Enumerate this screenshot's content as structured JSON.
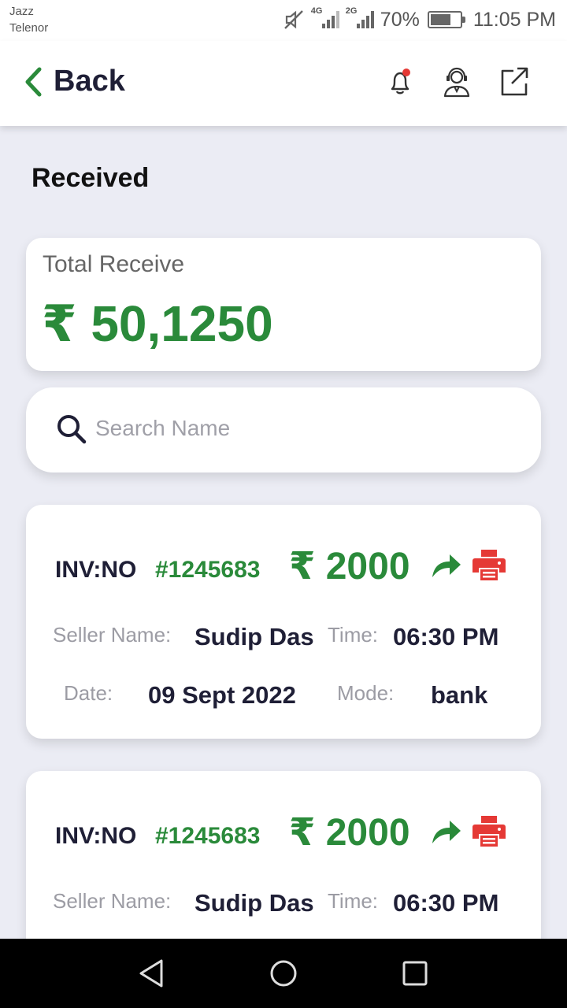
{
  "status_bar": {
    "carrier_1": "Jazz",
    "carrier_2": "Telenor",
    "network_1": "4G",
    "network_2": "2G",
    "battery": "70%",
    "battery_level": 0.7,
    "time": "11:05 PM"
  },
  "header": {
    "back_label": "Back",
    "icons": [
      "bell-icon",
      "support-agent-icon",
      "external-link-icon"
    ],
    "notification_dot_color": "#e53935"
  },
  "page_title": "Received",
  "summary": {
    "label": "Total Receive",
    "amount": "₹ 50,1250"
  },
  "search": {
    "placeholder": "Search Name",
    "value": ""
  },
  "invoices": [
    {
      "inv_label": "INV:NO",
      "inv_number": "#1245683",
      "amount": "₹ 2000",
      "seller_label": "Seller Name:",
      "seller": "Sudip Das",
      "time_label": "Time:",
      "time": "06:30 PM",
      "date_label": "Date:",
      "date": "09 Sept 2022",
      "mode_label": "Mode:",
      "mode": "bank"
    },
    {
      "inv_label": "INV:NO",
      "inv_number": "#1245683",
      "amount": "₹ 2000",
      "seller_label": "Seller Name:",
      "seller": "Sudip Das",
      "time_label": "Time:",
      "time": "06:30 PM"
    }
  ],
  "colors": {
    "accent_green": "#2a8a3a",
    "print_red": "#e53935",
    "background": "#ebecf4"
  }
}
